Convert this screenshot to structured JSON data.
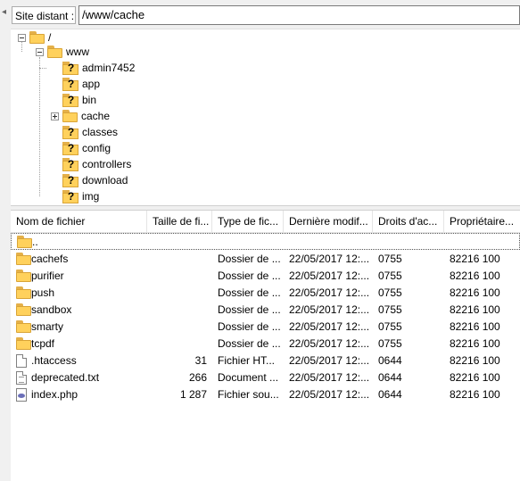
{
  "address": {
    "label": "Site distant :",
    "path": "/www/cache"
  },
  "tree": {
    "root": "/",
    "www": "www",
    "children": [
      "admin7452",
      "app",
      "bin",
      "cache",
      "classes",
      "config",
      "controllers",
      "download",
      "img"
    ]
  },
  "list": {
    "columns": [
      "Nom de fichier",
      "Taille de fi...",
      "Type de fic...",
      "Dernière modif...",
      "Droits d'ac...",
      "Propriétaire..."
    ],
    "parent": "..",
    "rows": [
      {
        "name": "cachefs",
        "size": "",
        "type": "Dossier de ...",
        "modified": "22/05/2017 12:...",
        "perms": "0755",
        "owner": "82216 100",
        "icon": "folder-icon"
      },
      {
        "name": "purifier",
        "size": "",
        "type": "Dossier de ...",
        "modified": "22/05/2017 12:...",
        "perms": "0755",
        "owner": "82216 100",
        "icon": "folder-icon"
      },
      {
        "name": "push",
        "size": "",
        "type": "Dossier de ...",
        "modified": "22/05/2017 12:...",
        "perms": "0755",
        "owner": "82216 100",
        "icon": "folder-icon"
      },
      {
        "name": "sandbox",
        "size": "",
        "type": "Dossier de ...",
        "modified": "22/05/2017 12:...",
        "perms": "0755",
        "owner": "82216 100",
        "icon": "folder-icon"
      },
      {
        "name": "smarty",
        "size": "",
        "type": "Dossier de ...",
        "modified": "22/05/2017 12:...",
        "perms": "0755",
        "owner": "82216 100",
        "icon": "folder-icon"
      },
      {
        "name": "tcpdf",
        "size": "",
        "type": "Dossier de ...",
        "modified": "22/05/2017 12:...",
        "perms": "0755",
        "owner": "82216 100",
        "icon": "folder-icon"
      },
      {
        "name": ".htaccess",
        "size": "31",
        "type": "Fichier HT...",
        "modified": "22/05/2017 12:...",
        "perms": "0644",
        "owner": "82216 100",
        "icon": "file-icon"
      },
      {
        "name": "deprecated.txt",
        "size": "266",
        "type": "Document ...",
        "modified": "22/05/2017 12:...",
        "perms": "0644",
        "owner": "82216 100",
        "icon": "text-file-icon"
      },
      {
        "name": "index.php",
        "size": "1 287",
        "type": "Fichier sou...",
        "modified": "22/05/2017 12:...",
        "perms": "0644",
        "owner": "82216 100",
        "icon": "php-file-icon"
      }
    ]
  }
}
